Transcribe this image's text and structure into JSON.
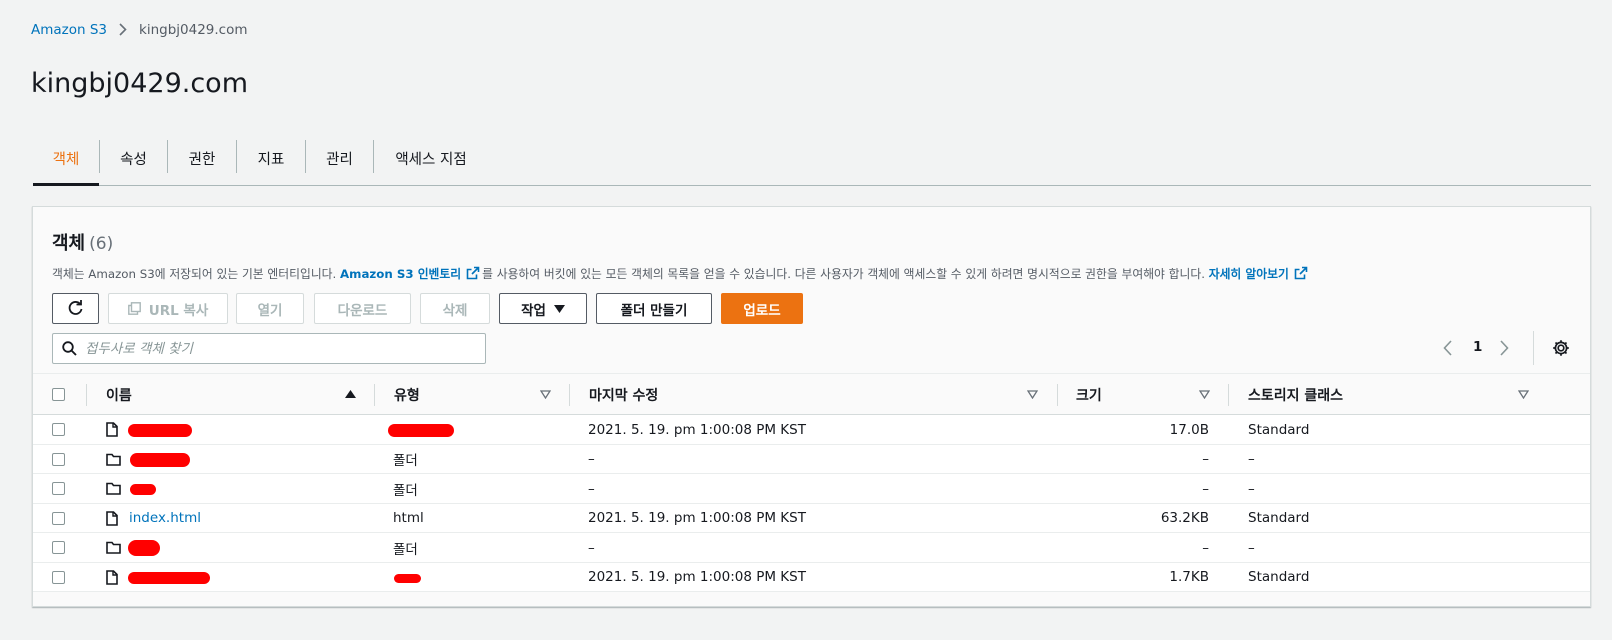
{
  "breadcrumb": {
    "root": "Amazon S3",
    "current": "kingbj0429.com"
  },
  "page_title": "kingbj0429.com",
  "tabs": [
    {
      "label": "객체",
      "active": true
    },
    {
      "label": "속성"
    },
    {
      "label": "권한"
    },
    {
      "label": "지표"
    },
    {
      "label": "관리"
    },
    {
      "label": "액세스 지점"
    }
  ],
  "panel": {
    "title": "객체",
    "count": "(6)",
    "desc_before": "객체는 Amazon S3에 저장되어 있는 기본 엔터티입니다. ",
    "desc_link1": "Amazon S3 인벤토리",
    "desc_middle": "를 사용하여 버킷에 있는 모든 객체의 목록을 얻을 수 있습니다. 다른 사용자가 객체에 액세스할 수 있게 하려면 명시적으로 권한을 부여해야 합니다. ",
    "desc_link2": "자세히 알아보기"
  },
  "toolbar": {
    "copy_url": "URL 복사",
    "open": "열기",
    "download": "다운로드",
    "delete": "삭제",
    "actions": "작업",
    "create_folder": "폴더 만들기",
    "upload": "업로드"
  },
  "search": {
    "placeholder": "접두사로 객체 찾기"
  },
  "pagination": {
    "page": "1"
  },
  "columns": {
    "name": "이름",
    "type": "유형",
    "modified": "마지막 수정",
    "size": "크기",
    "storage_class": "스토리지 클래스"
  },
  "rows": [
    {
      "icon": "file-icon",
      "name": "",
      "type": "",
      "modified": "2021. 5. 19. pm 1:00:08 PM KST",
      "size": "17.0B",
      "storage": "Standard"
    },
    {
      "icon": "folder-icon",
      "name": "",
      "type": "폴더",
      "modified": "–",
      "size": "–",
      "storage": "–"
    },
    {
      "icon": "folder-icon",
      "name": "",
      "type": "폴더",
      "modified": "–",
      "size": "–",
      "storage": "–"
    },
    {
      "icon": "file-icon",
      "name": "index.html",
      "type": "html",
      "modified": "2021. 5. 19. pm 1:00:08 PM KST",
      "size": "63.2KB",
      "storage": "Standard"
    },
    {
      "icon": "folder-icon",
      "name": "",
      "type": "폴더",
      "modified": "–",
      "size": "–",
      "storage": "–"
    },
    {
      "icon": "file-icon",
      "name": "",
      "type": "",
      "modified": "2021. 5. 19. pm 1:00:08 PM KST",
      "size": "1.7KB",
      "storage": "Standard"
    }
  ],
  "colors": {
    "accent": "#ec7211",
    "link": "#0073bb",
    "redaction": "#ff0000"
  }
}
